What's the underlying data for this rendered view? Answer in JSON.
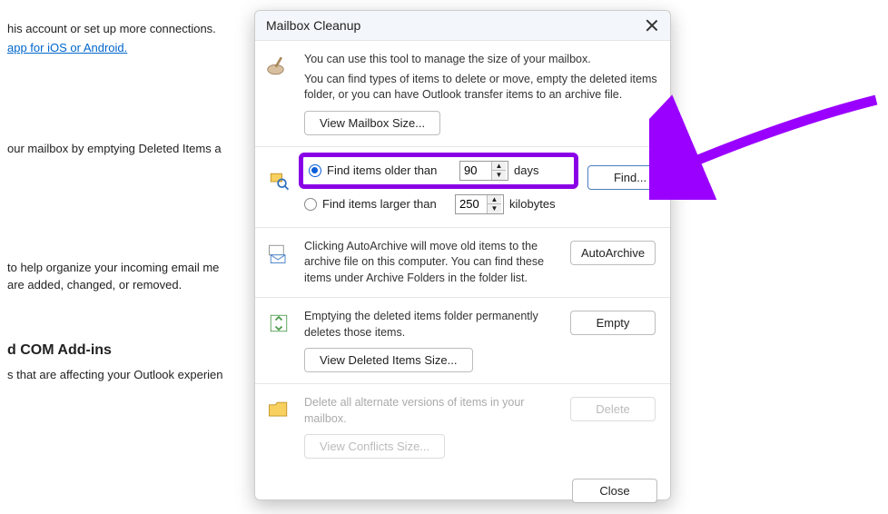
{
  "bg": {
    "line1": "his account or set up more connections.",
    "link": "app for iOS or Android.",
    "line3": "our mailbox by emptying Deleted Items a",
    "line4": "to help organize your incoming email me",
    "line5": "are added, changed, or removed.",
    "heading": "d COM Add-ins",
    "line6": "s that are affecting your Outlook experien"
  },
  "dialog": {
    "title": "Mailbox Cleanup",
    "intro1": "You can use this tool to manage the size of your mailbox.",
    "intro2": "You can find types of items to delete or move, empty the deleted items folder, or you can have Outlook transfer items to an archive file.",
    "view_mailbox_btn": "View Mailbox Size...",
    "find": {
      "older_label": "Find items older than",
      "older_value": "90",
      "older_unit": "days",
      "larger_label": "Find items larger than",
      "larger_value": "250",
      "larger_unit": "kilobytes",
      "find_btn": "Find..."
    },
    "autoarchive_text": "Clicking AutoArchive will move old items to the archive file on this computer. You can find these items under Archive Folders in the folder list.",
    "autoarchive_btn": "AutoArchive",
    "empty_text": "Emptying the deleted items folder permanently deletes those items.",
    "empty_btn": "Empty",
    "view_deleted_btn": "View Deleted Items Size...",
    "conflicts_text": "Delete all alternate versions of items in your mailbox.",
    "delete_btn": "Delete",
    "view_conflicts_btn": "View Conflicts Size...",
    "close_btn": "Close"
  },
  "arrow_color": "#9a00ff"
}
